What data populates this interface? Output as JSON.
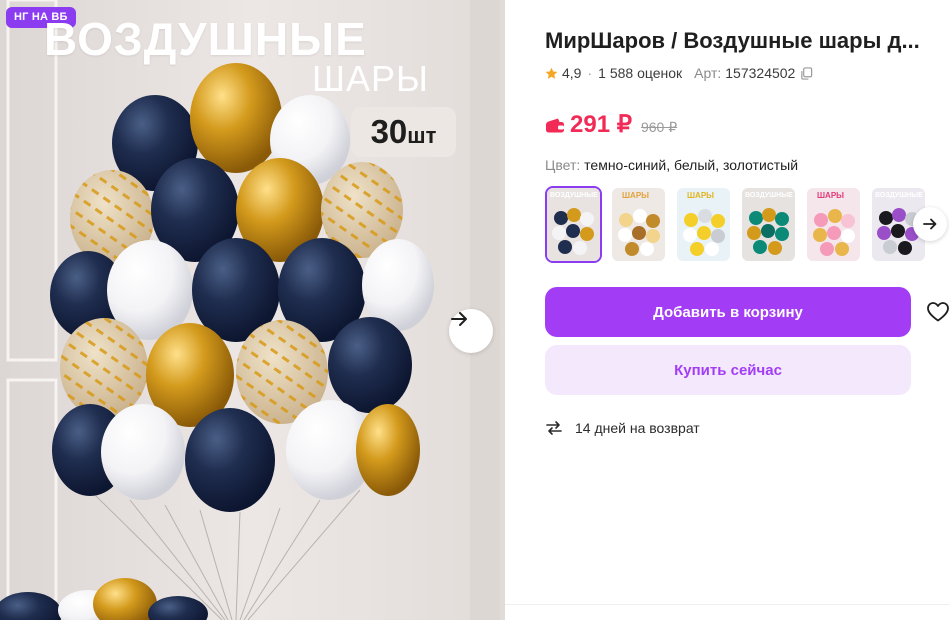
{
  "gallery": {
    "badge": "НГ НА ВБ",
    "promo_title": "ВОЗДУШНЫЕ",
    "promo_subtitle": "ШАРЫ",
    "promo_count": "30",
    "promo_count_unit": "шт"
  },
  "product": {
    "title": "МирШаров / Воздушные шары д...",
    "rating": "4,9",
    "reviews": "1 588 оценок",
    "article_label": "Арт:",
    "article": "157324502",
    "price": "291 ₽",
    "old_price": "960 ₽",
    "color_label": "Цвет:",
    "color_value": "темно-синий, белый, золотистый",
    "swatch_texts": [
      "ВОЗДУШНЫЕ",
      "ШАРЫ",
      "ШАРЫ",
      "ВОЗДУШНЫЕ",
      "ШАРЫ",
      "ВОЗДУШНЫЕ"
    ]
  },
  "actions": {
    "add_to_cart": "Добавить в корзину",
    "buy_now": "Купить сейчас"
  },
  "delivery": {
    "return_text": "14 дней на возврат"
  },
  "icons": [
    "next-arrow-icon",
    "star-icon",
    "copy-icon",
    "wallet-icon",
    "heart-icon",
    "return-icon"
  ],
  "colors": {
    "accent": "#a23df5",
    "price": "#f22a56",
    "badge": "#8b3cf0"
  }
}
